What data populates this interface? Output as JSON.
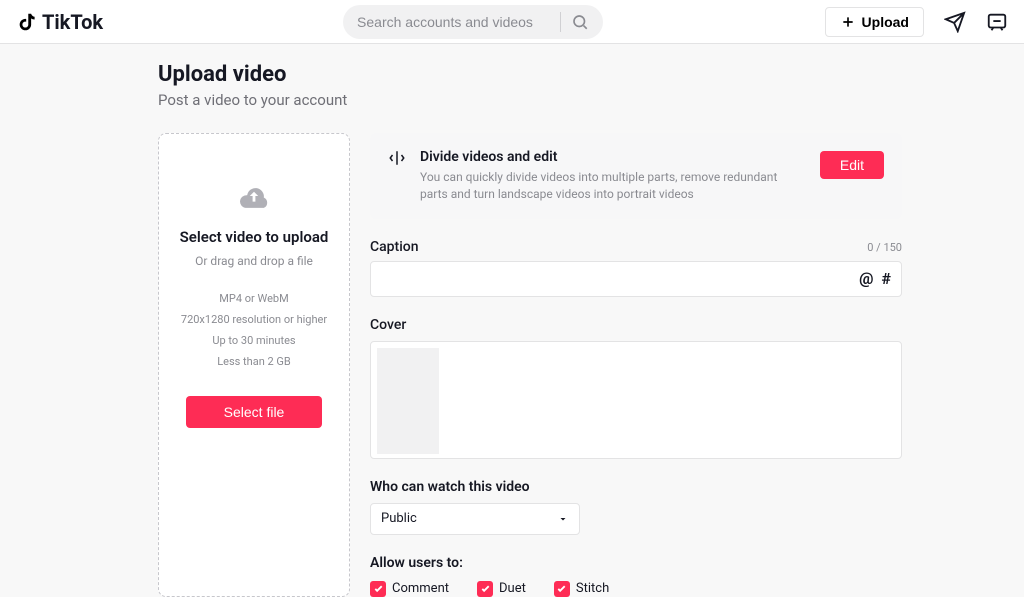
{
  "header": {
    "brand": "TikTok",
    "search_placeholder": "Search accounts and videos",
    "upload_label": "Upload"
  },
  "page": {
    "title": "Upload video",
    "subtitle": "Post a video to your account"
  },
  "upload_box": {
    "title": "Select video to upload",
    "subtitle": "Or drag and drop a file",
    "hints": {
      "format": "MP4 or WebM",
      "resolution": "720x1280 resolution or higher",
      "duration": "Up to 30 minutes",
      "size": "Less than 2 GB"
    },
    "button": "Select file"
  },
  "divide": {
    "title": "Divide videos and edit",
    "description": "You can quickly divide videos into multiple parts, remove redundant parts and turn landscape videos into portrait videos",
    "button": "Edit"
  },
  "caption": {
    "label": "Caption",
    "count": "0 / 150",
    "value": "",
    "at": "@",
    "hash": "#"
  },
  "cover": {
    "label": "Cover"
  },
  "privacy": {
    "label": "Who can watch this video",
    "selected": "Public"
  },
  "allow": {
    "label": "Allow users to:",
    "options": {
      "comment": "Comment",
      "duet": "Duet",
      "stitch": "Stitch"
    }
  }
}
